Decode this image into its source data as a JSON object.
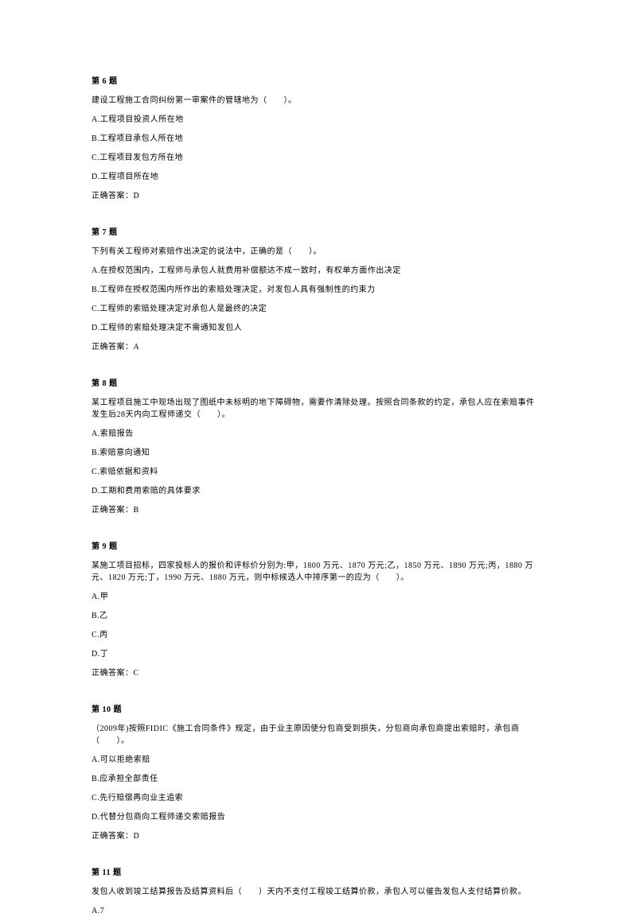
{
  "questions": [
    {
      "header": "第 6 题",
      "stem": "建设工程施工合同纠纷第一审案件的管辖地为（　　）。",
      "options": [
        "A.工程项目投资人所在地",
        "B.工程项目承包人所在地",
        "C.工程项目发包方所在地",
        "D.工程项目所在地"
      ],
      "answer": "正确答案：D"
    },
    {
      "header": "第 7 题",
      "stem": "下列有关工程师对索赔作出决定的说法中，正确的是（　　）。",
      "options": [
        "A.在授权范围内，工程师与承包人就费用补偿额达不成一致时，有权单方面作出决定",
        "B.工程师在授权范围内所作出的索赔处理决定，对发包人具有强制性的约束力",
        "C.工程师的索赔处理决定对承包人是最终的决定",
        "D.工程师的索赔处理决定不需通知发包人"
      ],
      "answer": "正确答案：A"
    },
    {
      "header": "第 8 题",
      "stem": "某工程项目施工中现场出现了图纸中未标明的地下障碍物，需要作清除处理。按照合同条款的约定，承包人应在索赔事件发生后28天内向工程师递交（　　）。",
      "options": [
        "A.索赔报告",
        "B.索赔意向通知",
        "C.索赔依据和资料",
        "D.工期和费用索赔的具体要求"
      ],
      "answer": "正确答案：B"
    },
    {
      "header": "第 9 题",
      "stem": "某施工项目招标，四家投标人的报价和评标价分别为:甲，1800 万元、1870 万元;乙，1850 万元、1890 万元;丙，1880 万元、1820 万元;丁，1990 万元、1880 万元，则中标候选人中排序第一的应为（　　）。",
      "options": [
        "A.甲",
        "B.乙",
        "C.丙",
        "D.丁"
      ],
      "answer": "正确答案：C"
    },
    {
      "header": "第 10 题",
      "stem": "（2009年)按照FIDIC《施工合同条件》规定，由于业主原因使分包商受到损失，分包商向承包商提出索赔时，承包商（　　）。",
      "options": [
        "A.可以拒绝索赔",
        "B.应承担全部责任",
        "C.先行赔偿再向业主追索",
        "D.代替分包商向工程师递交索赔报告"
      ],
      "answer": "正确答案：D"
    },
    {
      "header": "第 11 题",
      "stem": "发包人收到竣工结算报告及结算资料后（　　）天内不支付工程竣工结算价款，承包人可以催告发包人支付结算价款。",
      "options": [
        "A.7"
      ],
      "answer": null
    }
  ]
}
